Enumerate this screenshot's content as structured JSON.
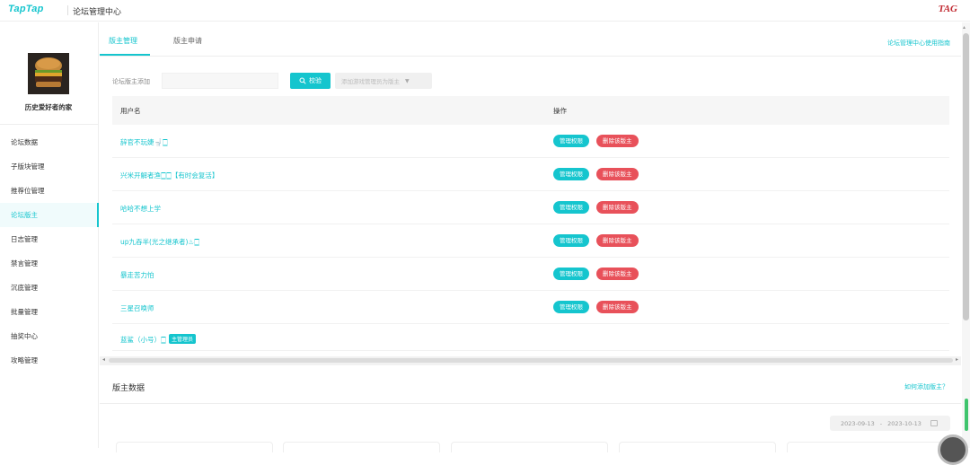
{
  "header": {
    "logo": "TapTap",
    "title": "论坛管理中心",
    "brand_right": "TAG"
  },
  "sidebar": {
    "username": "历史爱好者的家",
    "avatar_icon": "burger-avatar",
    "items": [
      {
        "label": "论坛数据",
        "active": false
      },
      {
        "label": "子版块管理",
        "active": false
      },
      {
        "label": "推荐位管理",
        "active": false
      },
      {
        "label": "论坛版主",
        "active": true
      },
      {
        "label": "日志管理",
        "active": false
      },
      {
        "label": "禁言管理",
        "active": false
      },
      {
        "label": "沉底管理",
        "active": false
      },
      {
        "label": "批量管理",
        "active": false
      },
      {
        "label": "抽奖中心",
        "active": false
      },
      {
        "label": "攻略管理",
        "active": false
      }
    ]
  },
  "tabs": [
    {
      "label": "版主管理",
      "active": true
    },
    {
      "label": "版主申请",
      "active": false
    }
  ],
  "guide_link": "论坛管理中心使用指南",
  "add_moderator": {
    "label": "论坛版主添加",
    "input_value": "",
    "verify_label": "校验",
    "dropdown_label": "添加游戏管理员为版主"
  },
  "table": {
    "columns": [
      "用户名",
      "操作"
    ],
    "manage_label": "管理权限",
    "delete_label": "删除该版主",
    "rows": [
      {
        "name": "辞官不玩婕🚽🀆"
      },
      {
        "name": "兴米开解者渔🀆🀆【有时会复活】"
      },
      {
        "name": "哈哈不想上学"
      },
      {
        "name": "up九吞半(光之继承者)♨🀆"
      },
      {
        "name": "暴走苦力怕"
      },
      {
        "name": "三星召唤师"
      }
    ],
    "last_row": {
      "name": "蓝鲨（小号）🀆",
      "badge": "主管理员"
    }
  },
  "moderator_data": {
    "title": "版主数据",
    "how_link": "如何添加版主？",
    "date_start": "2023-09-13",
    "date_sep": "-",
    "date_end": "2023-10-13"
  },
  "colors": {
    "accent": "#15c5ce",
    "danger": "#e8515a"
  }
}
